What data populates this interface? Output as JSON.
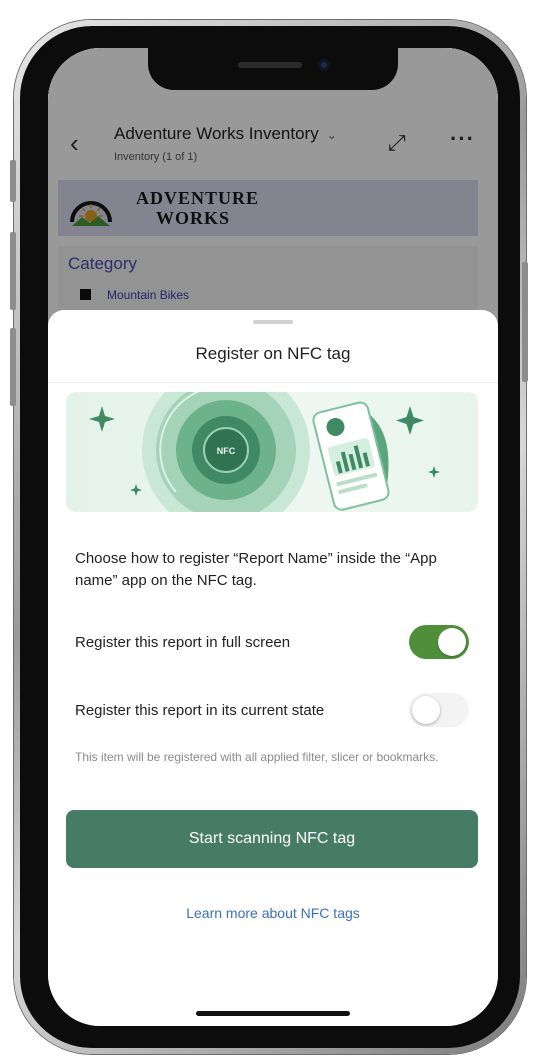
{
  "app": {
    "back_icon": "back-arrow-icon",
    "report_title": "Adventure Works Inventory",
    "report_title_chevron": "⌄",
    "report_subtitle": "Inventory (1 of 1)",
    "expand_icon": "expand-icon",
    "more_icon": "more-icon",
    "brand": {
      "line1": "ADVENTURE",
      "line2": "WORKS",
      "logo_icon": "adventure-works-logo"
    },
    "category": {
      "title": "Category",
      "items": [
        "Mountain Bikes"
      ]
    }
  },
  "sheet": {
    "title": "Register on NFC tag",
    "illustration": {
      "nfc_label": "NFC"
    },
    "description": "Choose how to register “Report Name” inside the “App name” app on the NFC tag.",
    "options": [
      {
        "label": "Register this report in full screen",
        "enabled": true
      },
      {
        "label": "Register this report in its current state",
        "enabled": false
      }
    ],
    "hint": "This item will be registered with all applied filter, slicer or bookmarks.",
    "primary_button": "Start scanning NFC tag",
    "learn_more_link": "Learn more about NFC tags"
  },
  "colors": {
    "accent_green": "#4f8f3a",
    "button_green": "#467c63",
    "link_blue": "#3a6fc4",
    "category_purple": "#4b4bb3",
    "brand_banner": "#dcdcf2"
  }
}
